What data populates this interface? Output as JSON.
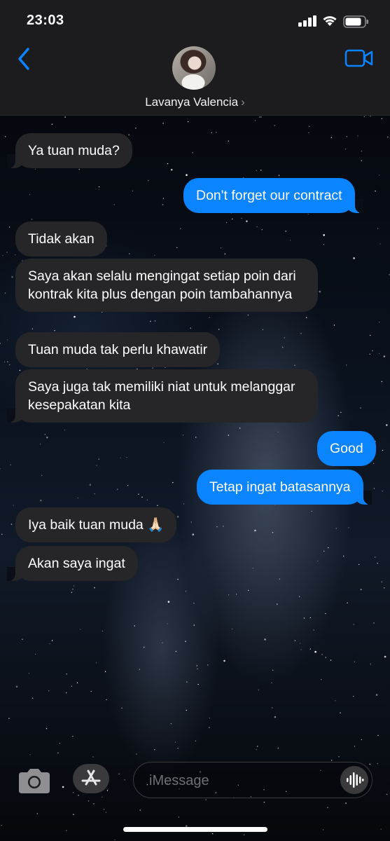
{
  "status_bar": {
    "time": "23:03",
    "signal_icon": "cellular-signal-icon",
    "wifi_icon": "wifi-icon",
    "battery_icon": "battery-icon"
  },
  "header": {
    "contact_name": "Lavanya Valencia",
    "contact_chevron": "›",
    "back_icon": "chevron-left-icon",
    "video_icon": "video-camera-icon",
    "accent_color": "#0a84ff"
  },
  "messages": [
    {
      "direction": "in",
      "text": "Ya tuan muda?"
    },
    {
      "direction": "out",
      "text": "Don't forget our contract"
    },
    {
      "direction": "in",
      "text": "Tidak akan"
    },
    {
      "direction": "in",
      "text": "Saya akan selalu mengingat setiap poin dari kontrak kita plus dengan poin tambahannya"
    },
    {
      "direction": "in",
      "text": "Tuan muda tak perlu khawatir"
    },
    {
      "direction": "in",
      "text": "Saya juga tak memiliki niat untuk melanggar kesepakatan kita"
    },
    {
      "direction": "out",
      "text": "Good"
    },
    {
      "direction": "out",
      "text": "Tetap ingat batasannya"
    },
    {
      "direction": "in",
      "text": "Iya baik tuan muda 🙏🏻"
    },
    {
      "direction": "in",
      "text": "Akan saya ingat"
    }
  ],
  "composer": {
    "placeholder": "iMessage",
    "camera_icon": "camera-icon",
    "apps_icon": "app-store-icon",
    "audio_icon": "audio-waveform-icon"
  },
  "colors": {
    "incoming_bubble": "#262628",
    "outgoing_bubble": "#0a84ff",
    "header_background": "#1c1c1e"
  }
}
